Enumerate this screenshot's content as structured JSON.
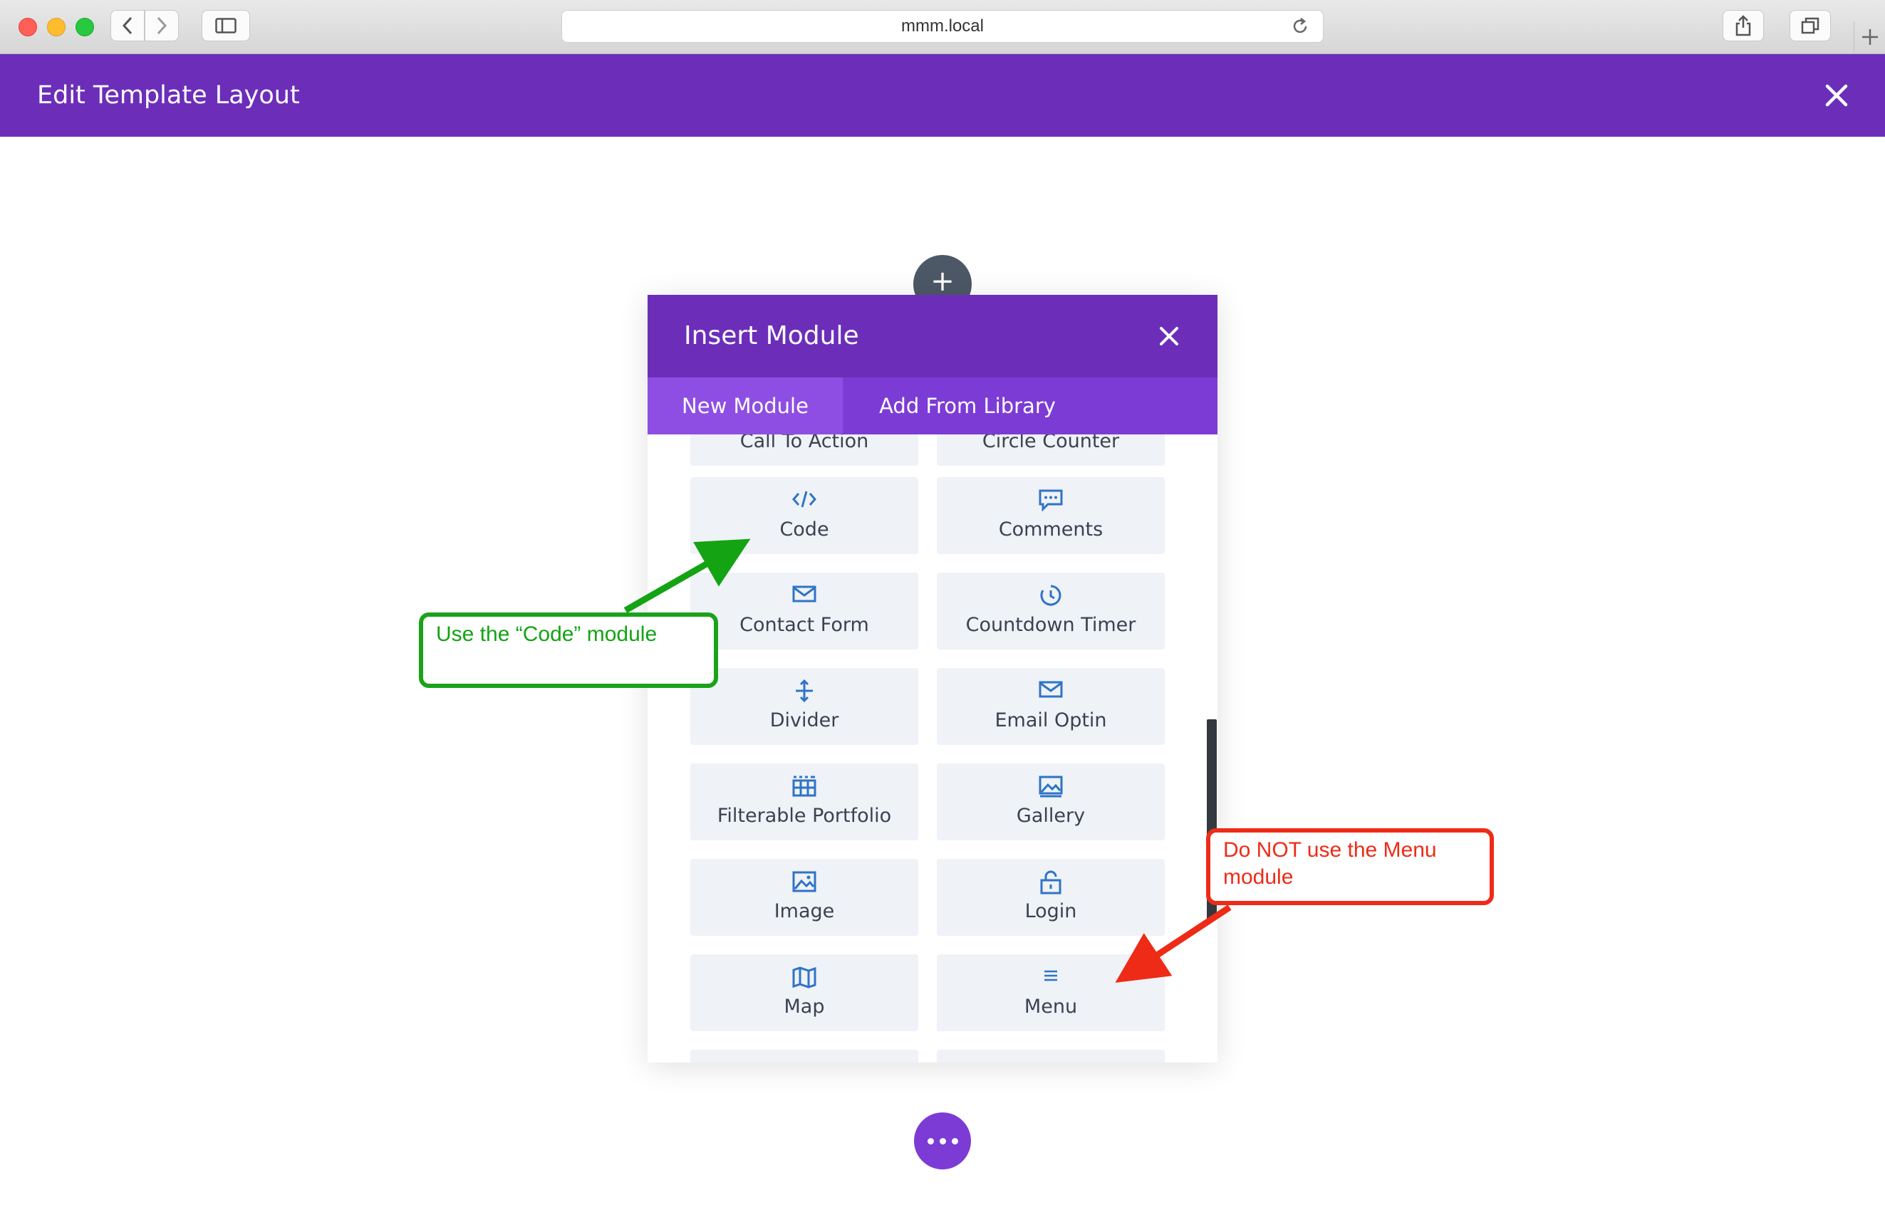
{
  "browser": {
    "url": "mmm.local"
  },
  "header": {
    "title": "Edit Template Layout"
  },
  "dialog": {
    "title": "Insert Module",
    "tabs": [
      {
        "label": "New Module",
        "active": true
      },
      {
        "label": "Add From Library",
        "active": false
      }
    ],
    "modules": [
      {
        "label": "Call To Action",
        "icon": "call-to-action-icon"
      },
      {
        "label": "Circle Counter",
        "icon": "circle-counter-icon"
      },
      {
        "label": "Code",
        "icon": "code-icon"
      },
      {
        "label": "Comments",
        "icon": "comments-icon"
      },
      {
        "label": "Contact Form",
        "icon": "envelope-icon"
      },
      {
        "label": "Countdown Timer",
        "icon": "timer-icon"
      },
      {
        "label": "Divider",
        "icon": "divider-icon"
      },
      {
        "label": "Email Optin",
        "icon": "envelope-icon"
      },
      {
        "label": "Filterable Portfolio",
        "icon": "grid-icon"
      },
      {
        "label": "Gallery",
        "icon": "gallery-icon"
      },
      {
        "label": "Image",
        "icon": "image-icon"
      },
      {
        "label": "Login",
        "icon": "lock-icon"
      },
      {
        "label": "Map",
        "icon": "map-icon"
      },
      {
        "label": "Menu",
        "icon": "menu-icon"
      }
    ]
  },
  "annotations": {
    "green_note": "Use the “Code” module",
    "red_note": "Do NOT use the Menu module"
  },
  "colors": {
    "purple_header": "#6c2eb9",
    "purple_tabs": "#7d3bd6",
    "icon_blue": "#2e74c7",
    "tile_bg": "#eff2f6",
    "green": "#13a313",
    "red": "#ee2b16"
  }
}
